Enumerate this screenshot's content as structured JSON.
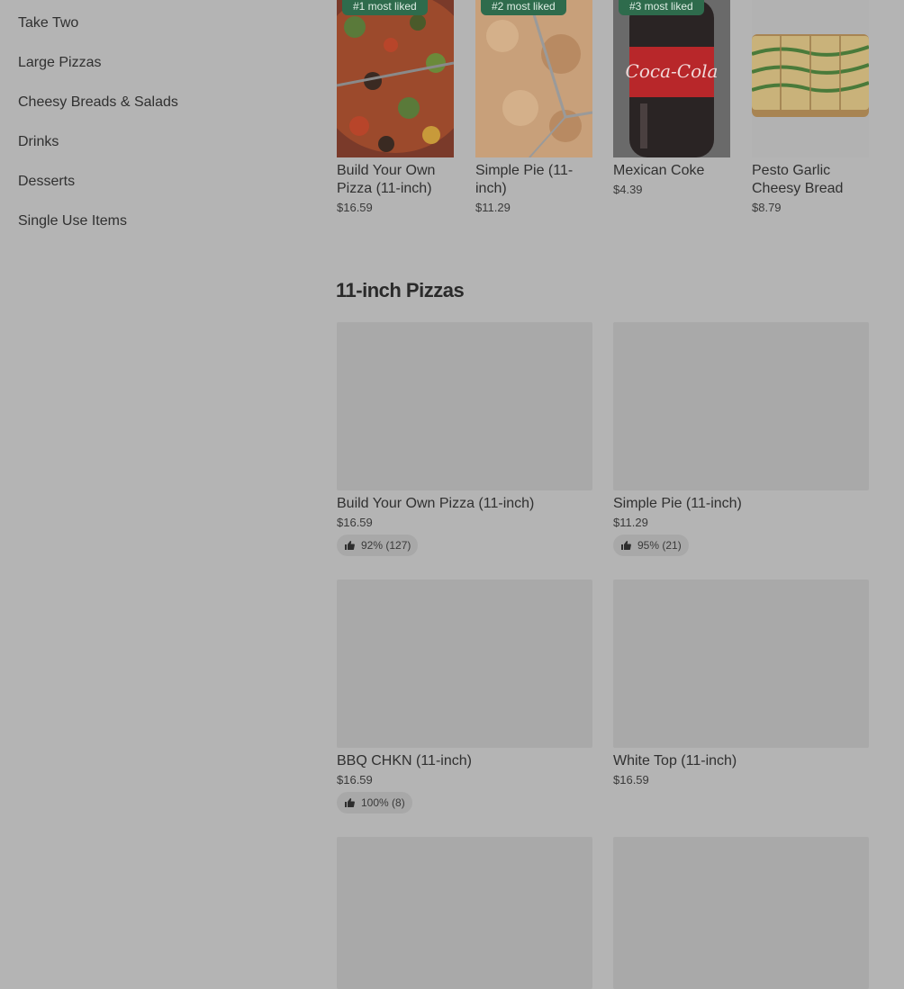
{
  "sidebar": {
    "items": [
      {
        "label": "Take Two"
      },
      {
        "label": "Large Pizzas"
      },
      {
        "label": "Cheesy Breads & Salads"
      },
      {
        "label": "Drinks"
      },
      {
        "label": "Desserts"
      },
      {
        "label": "Single Use Items"
      }
    ]
  },
  "most_liked": [
    {
      "badge": "#1 most liked",
      "name": "Build Your Own Pizza (11-inch)",
      "price": "$16.59"
    },
    {
      "badge": "#2 most liked",
      "name": "Simple Pie (11-inch)",
      "price": "$11.29"
    },
    {
      "badge": "#3 most liked",
      "name": "Mexican Coke",
      "price": "$4.39"
    },
    {
      "badge": "",
      "name": "Pesto Garlic Cheesy Bread",
      "price": "$8.79"
    }
  ],
  "section": {
    "title": "11-inch Pizzas"
  },
  "items": [
    {
      "name": "Build Your Own Pizza (11-inch)",
      "price": "$16.59",
      "rating": "92% (127)"
    },
    {
      "name": "Simple Pie (11-inch)",
      "price": "$11.29",
      "rating": "95% (21)"
    },
    {
      "name": "BBQ CHKN (11-inch)",
      "price": "$16.59",
      "rating": "100% (8)"
    },
    {
      "name": "White Top (11-inch)",
      "price": "$16.59"
    }
  ],
  "colors": {
    "overlay_background": "#b4b4b4",
    "badge_background": "#2e6b4c",
    "placeholder_image": "#a9a9a9"
  }
}
